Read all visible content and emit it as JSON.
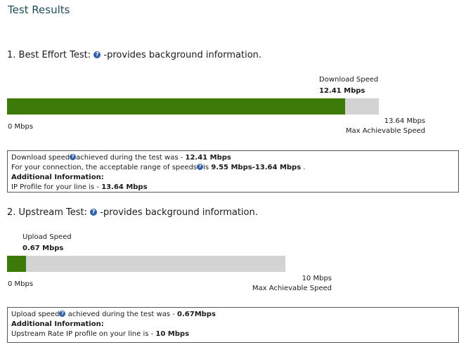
{
  "page_title": "Test Results",
  "help_glyph": "?",
  "best_effort": {
    "heading_prefix": "1. Best Effort Test:",
    "heading_suffix": "-provides background information.",
    "speed_label": "Download Speed",
    "speed_value": "12.41 Mbps",
    "min_label": "0 Mbps",
    "max_value": "13.64 Mbps",
    "max_label": "Max Achievable Speed",
    "progress_fraction": 0.9098,
    "info": {
      "line1_prefix": "Download speed",
      "line1_middle": "achieved during the test was - ",
      "line1_value": "12.41 Mbps",
      "line2_prefix": "For your connection, the acceptable range of speeds",
      "line2_middle": "is ",
      "line2_value": "9.55 Mbps-13.64 Mbps",
      "line2_suffix": " .",
      "line3": "Additional Information:",
      "line4_prefix": "IP Profile for your line is - ",
      "line4_value": "13.64 Mbps"
    }
  },
  "upstream": {
    "heading_prefix": "2. Upstream Test:",
    "heading_suffix": "-provides background information.",
    "speed_label": "Upload Speed",
    "speed_value": "0.67 Mbps",
    "min_label": "0 Mbps",
    "max_value": "10 Mbps",
    "max_label": "Max Achievable Speed",
    "progress_fraction": 0.067,
    "info": {
      "line1_prefix": "Upload speed",
      "line1_middle": " achieved during the test was - ",
      "line1_value": "0.67Mbps",
      "line2": "Additional Information:",
      "line3_prefix": "Upstream Rate IP profile on your line is - ",
      "line3_value": "10 Mbps"
    }
  },
  "colors": {
    "bar_fill": "#3d7a0a",
    "bar_track": "#d3d3d3",
    "title": "#1f4e56",
    "help_icon": "#2f5fa8"
  }
}
